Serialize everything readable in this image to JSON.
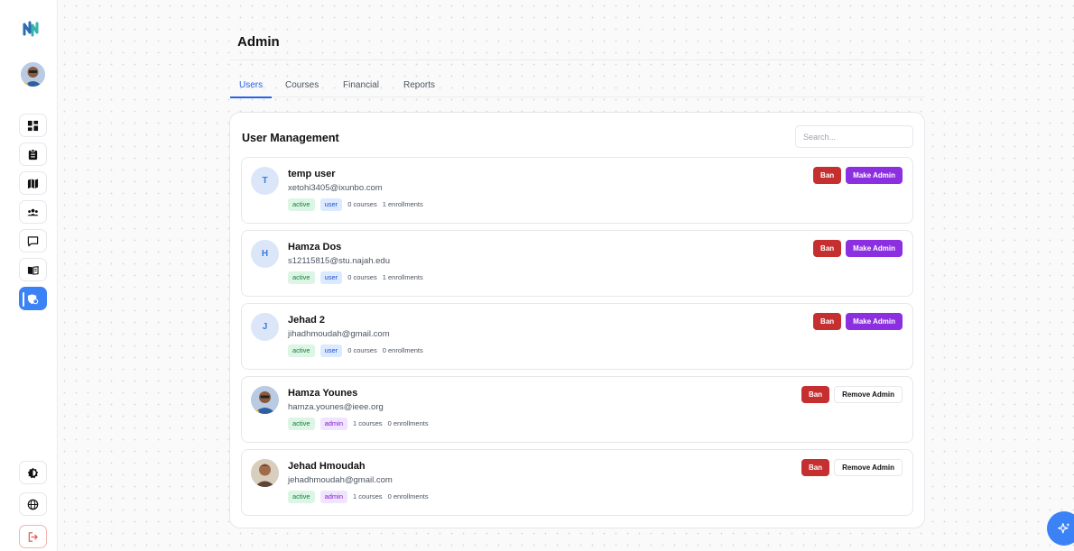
{
  "page": {
    "title": "Admin"
  },
  "tabs": [
    {
      "label": "Users",
      "active": true
    },
    {
      "label": "Courses",
      "active": false
    },
    {
      "label": "Financial",
      "active": false
    },
    {
      "label": "Reports",
      "active": false
    }
  ],
  "panel": {
    "title": "User Management",
    "search_placeholder": "Search..."
  },
  "users": [
    {
      "initial": "T",
      "name": "temp user",
      "email": "xetohi3405@ixunbo.com",
      "status": "active",
      "role": "user",
      "courses": "0 courses",
      "enrollments": "1 enrollments",
      "ban_label": "Ban",
      "admin_label": "Make Admin"
    },
    {
      "initial": "H",
      "name": "Hamza Dos",
      "email": "s12115815@stu.najah.edu",
      "status": "active",
      "role": "user",
      "courses": "0 courses",
      "enrollments": "1 enrollments",
      "ban_label": "Ban",
      "admin_label": "Make Admin"
    },
    {
      "initial": "J",
      "name": "Jehad 2",
      "email": "jihadhmoudah@gmail.com",
      "status": "active",
      "role": "user",
      "courses": "0 courses",
      "enrollments": "0 enrollments",
      "ban_label": "Ban",
      "admin_label": "Make Admin"
    },
    {
      "initial": "",
      "name": "Hamza Younes",
      "email": "hamza.younes@ieee.org",
      "status": "active",
      "role": "admin",
      "courses": "1 courses",
      "enrollments": "0 enrollments",
      "ban_label": "Ban",
      "admin_label": "Remove Admin"
    },
    {
      "initial": "",
      "name": "Jehad Hmoudah",
      "email": "jehadhmoudah@gmail.com",
      "status": "active",
      "role": "admin",
      "courses": "1 courses",
      "enrollments": "0 enrollments",
      "ban_label": "Ban",
      "admin_label": "Remove Admin"
    }
  ],
  "sidebar": {
    "nav": [
      "dashboard-icon",
      "clipboard-icon",
      "map-icon",
      "community-icon",
      "chat-icon",
      "book-icon",
      "admin-shield-icon"
    ],
    "bottom": [
      "theme-toggle-icon",
      "globe-icon",
      "logout-icon"
    ]
  },
  "colors": {
    "accent": "#2563eb",
    "ban": "#c62f2f",
    "make_admin": "#8b2fe0"
  }
}
